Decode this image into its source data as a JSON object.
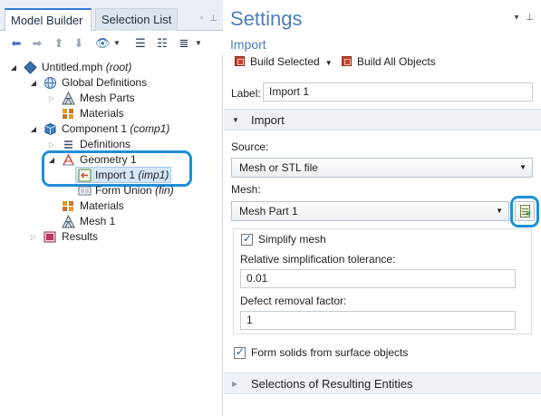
{
  "left_panel": {
    "tabs": {
      "active": "Model Builder",
      "inactive": "Selection List"
    },
    "tree": {
      "root": {
        "label": "Untitled.mph",
        "suffix": "(root)"
      },
      "global_definitions": {
        "label": "Global Definitions"
      },
      "mesh_parts": {
        "label": "Mesh Parts"
      },
      "global_materials": {
        "label": "Materials"
      },
      "component": {
        "label": "Component 1",
        "suffix": "(comp1)"
      },
      "definitions": {
        "label": "Definitions"
      },
      "geometry": {
        "label": "Geometry 1"
      },
      "import": {
        "label": "Import 1",
        "suffix": "(imp1)"
      },
      "form_union": {
        "label": "Form Union",
        "suffix": "(fin)"
      },
      "component_materials": {
        "label": "Materials"
      },
      "mesh": {
        "label": "Mesh 1"
      },
      "results": {
        "label": "Results"
      }
    }
  },
  "right_panel": {
    "title": "Settings",
    "subtitle": "Import",
    "build_selected": "Build Selected",
    "build_all": "Build All Objects",
    "label_field": {
      "label": "Label:",
      "value": "Import 1"
    },
    "section_import": "Import",
    "source": {
      "label": "Source:",
      "value": "Mesh or STL file"
    },
    "mesh": {
      "label": "Mesh:",
      "value": "Mesh Part 1"
    },
    "simplify": {
      "label": "Simplify mesh",
      "checked": true
    },
    "rel_tol": {
      "label": "Relative simplification tolerance:",
      "value": "0.01"
    },
    "defect": {
      "label": "Defect removal factor:",
      "value": "1"
    },
    "form_solids": {
      "label": "Form solids from surface objects",
      "checked": true
    },
    "section_selections": "Selections of Resulting Entities"
  },
  "colors": {
    "accent": "#4a7fbc",
    "highlight_ring": "#1e8fd8"
  }
}
